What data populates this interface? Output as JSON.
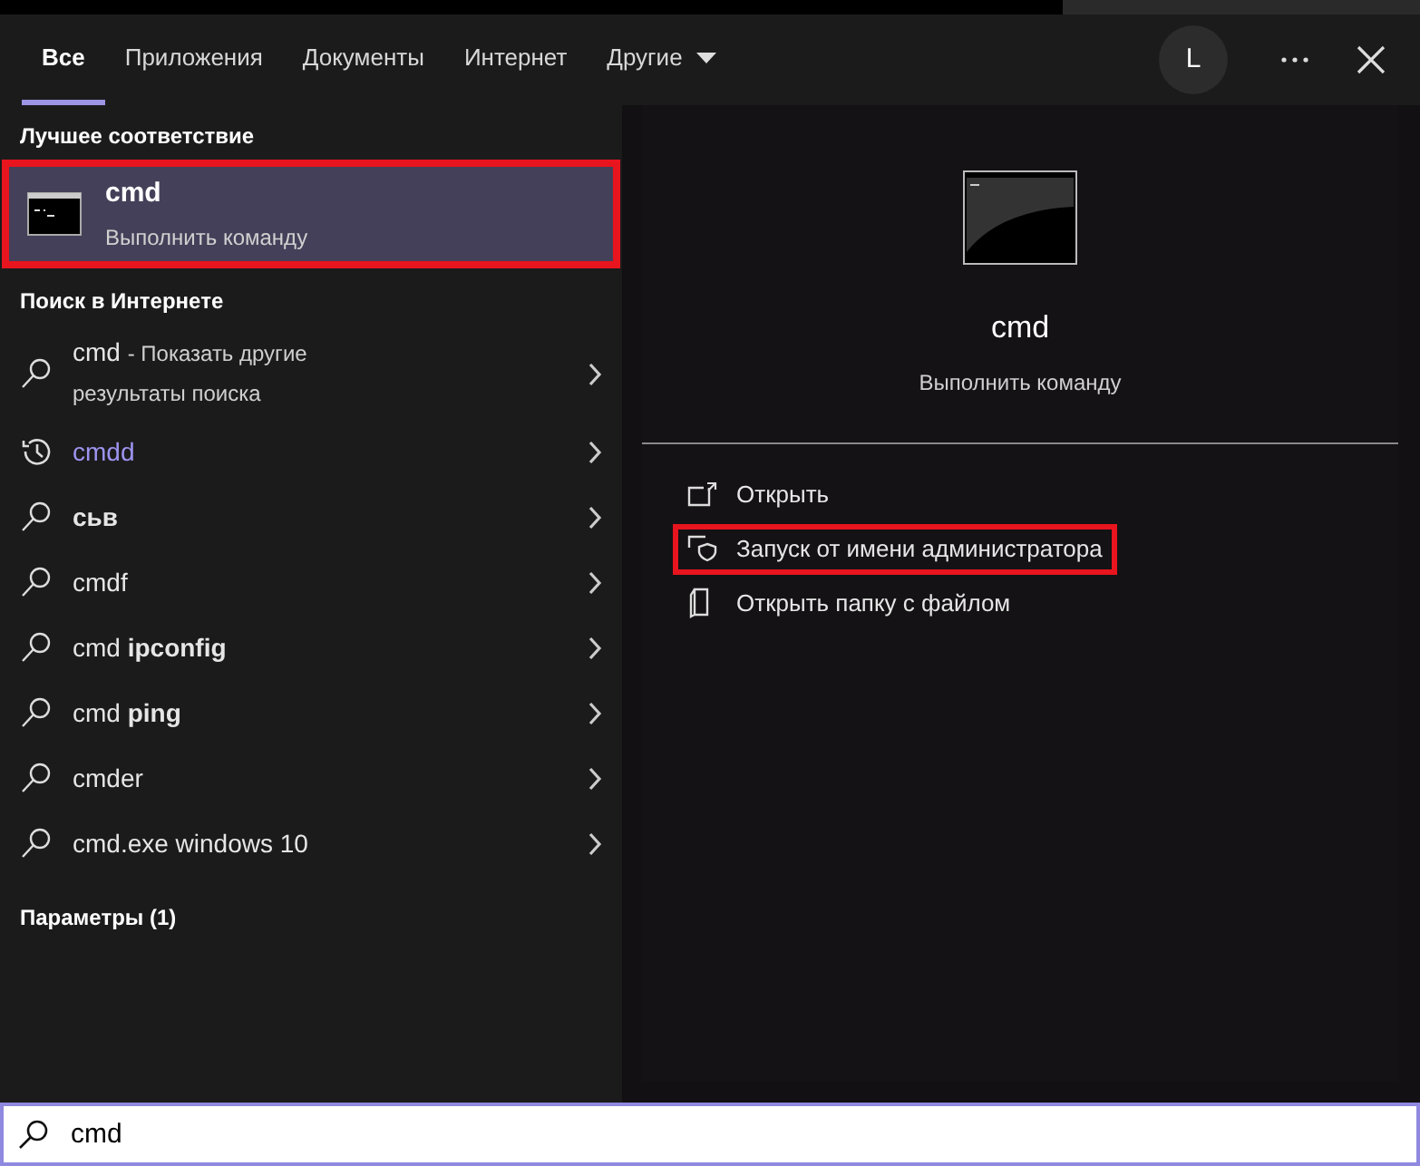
{
  "tabs": [
    {
      "label": "Все",
      "selected": true,
      "dropdown": false
    },
    {
      "label": "Приложения",
      "selected": false,
      "dropdown": false
    },
    {
      "label": "Документы",
      "selected": false,
      "dropdown": false
    },
    {
      "label": "Интернет",
      "selected": false,
      "dropdown": false
    },
    {
      "label": "Другие",
      "selected": false,
      "dropdown": true
    }
  ],
  "account": {
    "initial": "L"
  },
  "best_match": {
    "heading": "Лучшее соответствие",
    "title": "cmd",
    "subtitle": "Выполнить команду",
    "selected": true,
    "highlighted": true
  },
  "web_search": {
    "heading": "Поиск в Интернете",
    "items": [
      {
        "kind": "web",
        "text": "cmd",
        "note": "- Показать другие результаты поиска",
        "emphasis": false
      },
      {
        "kind": "history",
        "text": "cmdd",
        "emphasis": false
      },
      {
        "kind": "web",
        "text": "**сьв**",
        "emphasis": false
      },
      {
        "kind": "web",
        "text": "cmdf",
        "emphasis": false
      },
      {
        "kind": "web",
        "text": "cmd **ipconfig**",
        "emphasis": false
      },
      {
        "kind": "web",
        "text": "cmd **ping**",
        "emphasis": false
      },
      {
        "kind": "web",
        "text": "cmder",
        "emphasis": false
      },
      {
        "kind": "web",
        "text": "cmd.exe windows 10",
        "emphasis": false
      }
    ]
  },
  "settings_heading": "Параметры (1)",
  "preview": {
    "title": "cmd",
    "subtitle": "Выполнить команду",
    "actions": [
      {
        "kind": "open",
        "label": "Открыть",
        "highlighted": false
      },
      {
        "kind": "admin",
        "label": "Запуск от имени администратора",
        "highlighted": true
      },
      {
        "kind": "folder",
        "label": "Открыть папку с файлом",
        "highlighted": false
      }
    ]
  },
  "search": {
    "value": "cmd"
  }
}
